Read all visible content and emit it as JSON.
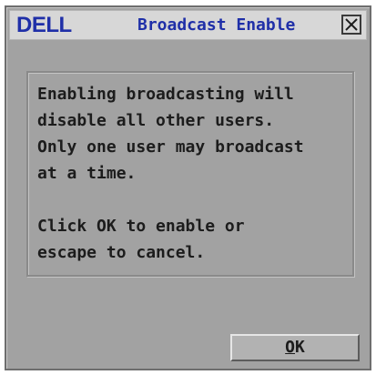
{
  "titlebar": {
    "logo_text": "DELL",
    "title": "Broadcast Enable",
    "close_icon": "close-x-icon"
  },
  "message": {
    "lines": [
      "Enabling broadcasting will",
      "disable all other users.",
      "Only one user may broadcast",
      "at a time.",
      "",
      "Click OK to enable or",
      "escape to cancel."
    ]
  },
  "buttons": {
    "ok_accel": "O",
    "ok_rest": "K"
  },
  "colors": {
    "title_text": "#1f2fa8",
    "dialog_bg": "#a2a2a2",
    "titlebar_bg": "#d7d7d7"
  }
}
